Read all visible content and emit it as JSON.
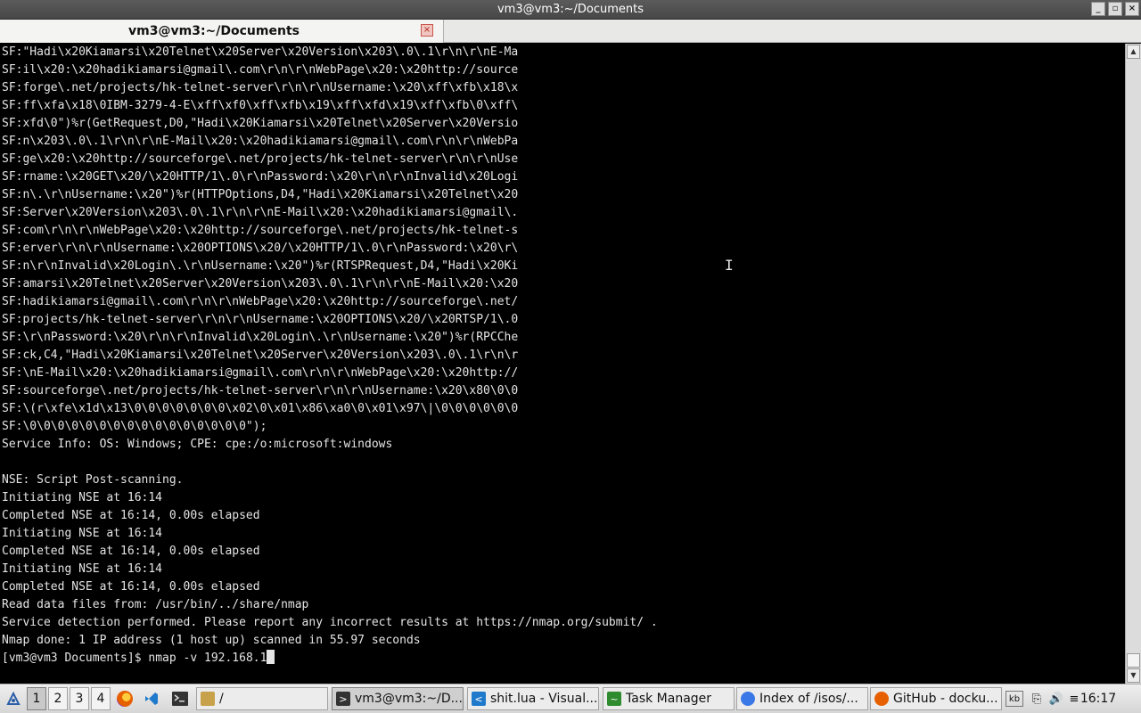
{
  "window": {
    "title": "vm3@vm3:~/Documents",
    "buttons": {
      "minimize": "_",
      "maximize": "▫",
      "close": "×"
    }
  },
  "tab": {
    "label": "vm3@vm3:~/Documents",
    "close": "×"
  },
  "terminal": {
    "lines": [
      "SF:\"Hadi\\x20Kiamarsi\\x20Telnet\\x20Server\\x20Version\\x203\\.0\\.1\\r\\n\\r\\nE-Ma",
      "SF:il\\x20:\\x20hadikiamarsi@gmail\\.com\\r\\n\\r\\nWebPage\\x20:\\x20http://source",
      "SF:forge\\.net/projects/hk-telnet-server\\r\\n\\r\\nUsername:\\x20\\xff\\xfb\\x18\\x",
      "SF:ff\\xfa\\x18\\0IBM-3279-4-E\\xff\\xf0\\xff\\xfb\\x19\\xff\\xfd\\x19\\xff\\xfb\\0\\xff\\",
      "SF:xfd\\0\")%r(GetRequest,D0,\"Hadi\\x20Kiamarsi\\x20Telnet\\x20Server\\x20Versio",
      "SF:n\\x203\\.0\\.1\\r\\n\\r\\nE-Mail\\x20:\\x20hadikiamarsi@gmail\\.com\\r\\n\\r\\nWebPa",
      "SF:ge\\x20:\\x20http://sourceforge\\.net/projects/hk-telnet-server\\r\\n\\r\\nUse",
      "SF:rname:\\x20GET\\x20/\\x20HTTP/1\\.0\\r\\nPassword:\\x20\\r\\n\\r\\nInvalid\\x20Logi",
      "SF:n\\.\\r\\nUsername:\\x20\")%r(HTTPOptions,D4,\"Hadi\\x20Kiamarsi\\x20Telnet\\x20",
      "SF:Server\\x20Version\\x203\\.0\\.1\\r\\n\\r\\nE-Mail\\x20:\\x20hadikiamarsi@gmail\\.",
      "SF:com\\r\\n\\r\\nWebPage\\x20:\\x20http://sourceforge\\.net/projects/hk-telnet-s",
      "SF:erver\\r\\n\\r\\nUsername:\\x20OPTIONS\\x20/\\x20HTTP/1\\.0\\r\\nPassword:\\x20\\r\\",
      "SF:n\\r\\nInvalid\\x20Login\\.\\r\\nUsername:\\x20\")%r(RTSPRequest,D4,\"Hadi\\x20Ki",
      "SF:amarsi\\x20Telnet\\x20Server\\x20Version\\x203\\.0\\.1\\r\\n\\r\\nE-Mail\\x20:\\x20",
      "SF:hadikiamarsi@gmail\\.com\\r\\n\\r\\nWebPage\\x20:\\x20http://sourceforge\\.net/",
      "SF:projects/hk-telnet-server\\r\\n\\r\\nUsername:\\x20OPTIONS\\x20/\\x20RTSP/1\\.0",
      "SF:\\r\\nPassword:\\x20\\r\\n\\r\\nInvalid\\x20Login\\.\\r\\nUsername:\\x20\")%r(RPCChe",
      "SF:ck,C4,\"Hadi\\x20Kiamarsi\\x20Telnet\\x20Server\\x20Version\\x203\\.0\\.1\\r\\n\\r",
      "SF:\\nE-Mail\\x20:\\x20hadikiamarsi@gmail\\.com\\r\\n\\r\\nWebPage\\x20:\\x20http://",
      "SF:sourceforge\\.net/projects/hk-telnet-server\\r\\n\\r\\nUsername:\\x20\\x80\\0\\0",
      "SF:\\(r\\xfe\\x1d\\x13\\0\\0\\0\\0\\0\\0\\0\\x02\\0\\x01\\x86\\xa0\\0\\x01\\x97\\|\\0\\0\\0\\0\\0\\0",
      "SF:\\0\\0\\0\\0\\0\\0\\0\\0\\0\\0\\0\\0\\0\\0\\0\\0\");",
      "Service Info: OS: Windows; CPE: cpe:/o:microsoft:windows",
      "",
      "NSE: Script Post-scanning.",
      "Initiating NSE at 16:14",
      "Completed NSE at 16:14, 0.00s elapsed",
      "Initiating NSE at 16:14",
      "Completed NSE at 16:14, 0.00s elapsed",
      "Initiating NSE at 16:14",
      "Completed NSE at 16:14, 0.00s elapsed",
      "Read data files from: /usr/bin/../share/nmap",
      "Service detection performed. Please report any incorrect results at https://nmap.org/submit/ .",
      "Nmap done: 1 IP address (1 host up) scanned in 55.97 seconds"
    ],
    "prompt": "[vm3@vm3 Documents]$ ",
    "command": "nmap -v 192.168.1",
    "mouse_cursor": "I"
  },
  "scrollbar": {
    "up": "▲",
    "down": "▼"
  },
  "taskbar": {
    "menu_icon": "start-menu-icon",
    "workspaces": [
      "1",
      "2",
      "3",
      "4"
    ],
    "active_workspace": "1",
    "quick_launch": [
      {
        "name": "firefox-icon",
        "color": "#e66000"
      },
      {
        "name": "vscode-icon",
        "color": "#1f7acc"
      },
      {
        "name": "terminal-icon",
        "color": "#333333"
      }
    ],
    "tasks": [
      {
        "label": "/",
        "icon": "folder-icon",
        "color": "#c8a24a"
      },
      {
        "label": "vm3@vm3:~/D...",
        "icon": "terminal-icon",
        "color": "#333333",
        "active": true
      },
      {
        "label": "shit.lua - Visual...",
        "icon": "vscode-icon",
        "color": "#1f7acc"
      },
      {
        "label": "Task Manager",
        "icon": "task-manager-icon",
        "color": "#2e8b2e"
      },
      {
        "label": "Index of /isos/...",
        "icon": "chromium-icon",
        "color": "#3b78e7"
      },
      {
        "label": "GitHub - docku...",
        "icon": "firefox-icon",
        "color": "#e66000"
      }
    ],
    "tray": {
      "keyboard": "kb",
      "clipboard": "⎘",
      "volume": "🔊",
      "settings": "≡"
    },
    "clock": "16:17"
  }
}
